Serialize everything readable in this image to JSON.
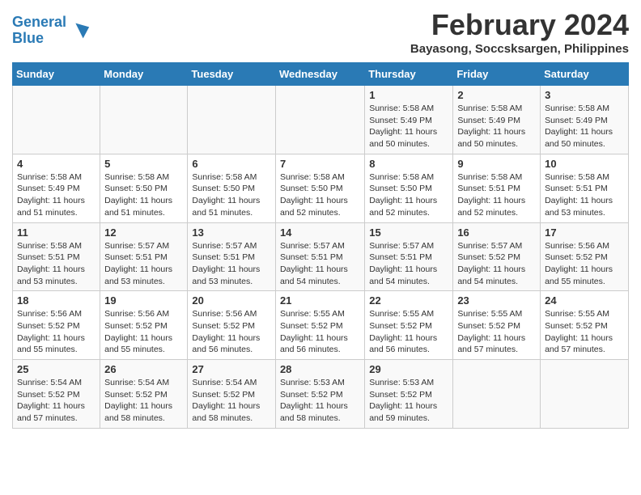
{
  "logo": {
    "line1": "General",
    "line2": "Blue"
  },
  "title": "February 2024",
  "subtitle": "Bayasong, Soccsksargen, Philippines",
  "headers": [
    "Sunday",
    "Monday",
    "Tuesday",
    "Wednesday",
    "Thursday",
    "Friday",
    "Saturday"
  ],
  "weeks": [
    [
      {
        "day": "",
        "sunrise": "",
        "sunset": "",
        "daylight": ""
      },
      {
        "day": "",
        "sunrise": "",
        "sunset": "",
        "daylight": ""
      },
      {
        "day": "",
        "sunrise": "",
        "sunset": "",
        "daylight": ""
      },
      {
        "day": "",
        "sunrise": "",
        "sunset": "",
        "daylight": ""
      },
      {
        "day": "1",
        "sunrise": "Sunrise: 5:58 AM",
        "sunset": "Sunset: 5:49 PM",
        "daylight": "Daylight: 11 hours and 50 minutes."
      },
      {
        "day": "2",
        "sunrise": "Sunrise: 5:58 AM",
        "sunset": "Sunset: 5:49 PM",
        "daylight": "Daylight: 11 hours and 50 minutes."
      },
      {
        "day": "3",
        "sunrise": "Sunrise: 5:58 AM",
        "sunset": "Sunset: 5:49 PM",
        "daylight": "Daylight: 11 hours and 50 minutes."
      }
    ],
    [
      {
        "day": "4",
        "sunrise": "Sunrise: 5:58 AM",
        "sunset": "Sunset: 5:49 PM",
        "daylight": "Daylight: 11 hours and 51 minutes."
      },
      {
        "day": "5",
        "sunrise": "Sunrise: 5:58 AM",
        "sunset": "Sunset: 5:50 PM",
        "daylight": "Daylight: 11 hours and 51 minutes."
      },
      {
        "day": "6",
        "sunrise": "Sunrise: 5:58 AM",
        "sunset": "Sunset: 5:50 PM",
        "daylight": "Daylight: 11 hours and 51 minutes."
      },
      {
        "day": "7",
        "sunrise": "Sunrise: 5:58 AM",
        "sunset": "Sunset: 5:50 PM",
        "daylight": "Daylight: 11 hours and 52 minutes."
      },
      {
        "day": "8",
        "sunrise": "Sunrise: 5:58 AM",
        "sunset": "Sunset: 5:50 PM",
        "daylight": "Daylight: 11 hours and 52 minutes."
      },
      {
        "day": "9",
        "sunrise": "Sunrise: 5:58 AM",
        "sunset": "Sunset: 5:51 PM",
        "daylight": "Daylight: 11 hours and 52 minutes."
      },
      {
        "day": "10",
        "sunrise": "Sunrise: 5:58 AM",
        "sunset": "Sunset: 5:51 PM",
        "daylight": "Daylight: 11 hours and 53 minutes."
      }
    ],
    [
      {
        "day": "11",
        "sunrise": "Sunrise: 5:58 AM",
        "sunset": "Sunset: 5:51 PM",
        "daylight": "Daylight: 11 hours and 53 minutes."
      },
      {
        "day": "12",
        "sunrise": "Sunrise: 5:57 AM",
        "sunset": "Sunset: 5:51 PM",
        "daylight": "Daylight: 11 hours and 53 minutes."
      },
      {
        "day": "13",
        "sunrise": "Sunrise: 5:57 AM",
        "sunset": "Sunset: 5:51 PM",
        "daylight": "Daylight: 11 hours and 53 minutes."
      },
      {
        "day": "14",
        "sunrise": "Sunrise: 5:57 AM",
        "sunset": "Sunset: 5:51 PM",
        "daylight": "Daylight: 11 hours and 54 minutes."
      },
      {
        "day": "15",
        "sunrise": "Sunrise: 5:57 AM",
        "sunset": "Sunset: 5:51 PM",
        "daylight": "Daylight: 11 hours and 54 minutes."
      },
      {
        "day": "16",
        "sunrise": "Sunrise: 5:57 AM",
        "sunset": "Sunset: 5:52 PM",
        "daylight": "Daylight: 11 hours and 54 minutes."
      },
      {
        "day": "17",
        "sunrise": "Sunrise: 5:56 AM",
        "sunset": "Sunset: 5:52 PM",
        "daylight": "Daylight: 11 hours and 55 minutes."
      }
    ],
    [
      {
        "day": "18",
        "sunrise": "Sunrise: 5:56 AM",
        "sunset": "Sunset: 5:52 PM",
        "daylight": "Daylight: 11 hours and 55 minutes."
      },
      {
        "day": "19",
        "sunrise": "Sunrise: 5:56 AM",
        "sunset": "Sunset: 5:52 PM",
        "daylight": "Daylight: 11 hours and 55 minutes."
      },
      {
        "day": "20",
        "sunrise": "Sunrise: 5:56 AM",
        "sunset": "Sunset: 5:52 PM",
        "daylight": "Daylight: 11 hours and 56 minutes."
      },
      {
        "day": "21",
        "sunrise": "Sunrise: 5:55 AM",
        "sunset": "Sunset: 5:52 PM",
        "daylight": "Daylight: 11 hours and 56 minutes."
      },
      {
        "day": "22",
        "sunrise": "Sunrise: 5:55 AM",
        "sunset": "Sunset: 5:52 PM",
        "daylight": "Daylight: 11 hours and 56 minutes."
      },
      {
        "day": "23",
        "sunrise": "Sunrise: 5:55 AM",
        "sunset": "Sunset: 5:52 PM",
        "daylight": "Daylight: 11 hours and 57 minutes."
      },
      {
        "day": "24",
        "sunrise": "Sunrise: 5:55 AM",
        "sunset": "Sunset: 5:52 PM",
        "daylight": "Daylight: 11 hours and 57 minutes."
      }
    ],
    [
      {
        "day": "25",
        "sunrise": "Sunrise: 5:54 AM",
        "sunset": "Sunset: 5:52 PM",
        "daylight": "Daylight: 11 hours and 57 minutes."
      },
      {
        "day": "26",
        "sunrise": "Sunrise: 5:54 AM",
        "sunset": "Sunset: 5:52 PM",
        "daylight": "Daylight: 11 hours and 58 minutes."
      },
      {
        "day": "27",
        "sunrise": "Sunrise: 5:54 AM",
        "sunset": "Sunset: 5:52 PM",
        "daylight": "Daylight: 11 hours and 58 minutes."
      },
      {
        "day": "28",
        "sunrise": "Sunrise: 5:53 AM",
        "sunset": "Sunset: 5:52 PM",
        "daylight": "Daylight: 11 hours and 58 minutes."
      },
      {
        "day": "29",
        "sunrise": "Sunrise: 5:53 AM",
        "sunset": "Sunset: 5:52 PM",
        "daylight": "Daylight: 11 hours and 59 minutes."
      },
      {
        "day": "",
        "sunrise": "",
        "sunset": "",
        "daylight": ""
      },
      {
        "day": "",
        "sunrise": "",
        "sunset": "",
        "daylight": ""
      }
    ]
  ]
}
